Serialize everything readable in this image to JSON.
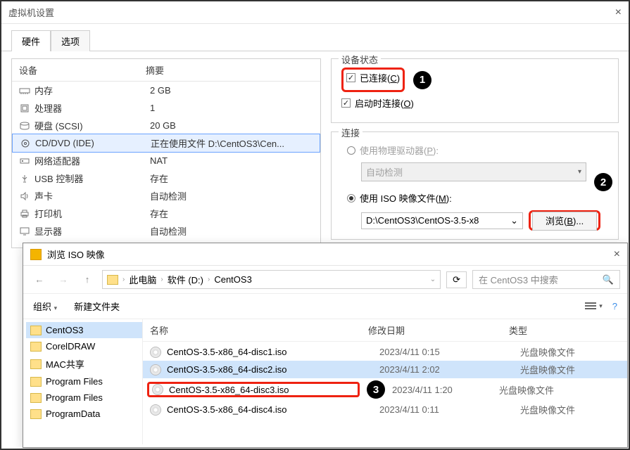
{
  "window": {
    "title": "虚拟机设置",
    "close": "×"
  },
  "tabs": {
    "hardware": "硬件",
    "options": "选项"
  },
  "hardware": {
    "device_header": "设备",
    "summary_header": "摘要",
    "rows": [
      {
        "name": "内存",
        "summary": "2 GB"
      },
      {
        "name": "处理器",
        "summary": "1"
      },
      {
        "name": "硬盘 (SCSI)",
        "summary": "20 GB"
      },
      {
        "name": "CD/DVD (IDE)",
        "summary": "正在使用文件 D:\\CentOS3\\Cen..."
      },
      {
        "name": "网络适配器",
        "summary": "NAT"
      },
      {
        "name": "USB 控制器",
        "summary": "存在"
      },
      {
        "name": "声卡",
        "summary": "自动检测"
      },
      {
        "name": "打印机",
        "summary": "存在"
      },
      {
        "name": "显示器",
        "summary": "自动检测"
      }
    ]
  },
  "device_status": {
    "title": "设备状态",
    "connected_prefix": "已连接(",
    "connected_letter": "C",
    "connected_suffix": ")",
    "connect_at_poweron_prefix": "启动时连接(",
    "connect_at_poweron_letter": "O",
    "connect_at_poweron_suffix": ")"
  },
  "connection": {
    "title": "连接",
    "use_physical_prefix": "使用物理驱动器(",
    "use_physical_letter": "P",
    "use_physical_suffix": "):",
    "autodetect": "自动检测",
    "use_iso_prefix": "使用 ISO 映像文件(",
    "use_iso_letter": "M",
    "use_iso_suffix": "):",
    "iso_path": "D:\\CentOS3\\CentOS-3.5-x8",
    "browse_prefix": "浏览(",
    "browse_letter": "B",
    "browse_suffix": ")..."
  },
  "annotations": {
    "one": "1",
    "two": "2",
    "three": "3"
  },
  "file_dialog": {
    "title": "浏览 ISO 映像",
    "close": "×",
    "crumbs": {
      "computer": "此电脑",
      "drive": "软件 (D:)",
      "folder": "CentOS3"
    },
    "search_placeholder": "在 CentOS3 中搜索",
    "toolbar": {
      "organize": "组织",
      "new_folder": "新建文件夹"
    },
    "tree": [
      "CentOS3",
      "CorelDRAW",
      "MAC共享",
      "Program Files",
      "Program Files",
      "ProgramData"
    ],
    "headers": {
      "name": "名称",
      "date": "修改日期",
      "type": "类型"
    },
    "files": [
      {
        "name": "CentOS-3.5-x86_64-disc1.iso",
        "date": "2023/4/11 0:15",
        "type": "光盘映像文件"
      },
      {
        "name": "CentOS-3.5-x86_64-disc2.iso",
        "date": "2023/4/11 2:02",
        "type": "光盘映像文件"
      },
      {
        "name": "CentOS-3.5-x86_64-disc3.iso",
        "date": "2023/4/11 1:20",
        "type": "光盘映像文件"
      },
      {
        "name": "CentOS-3.5-x86_64-disc4.iso",
        "date": "2023/4/11 0:11",
        "type": "光盘映像文件"
      }
    ]
  }
}
